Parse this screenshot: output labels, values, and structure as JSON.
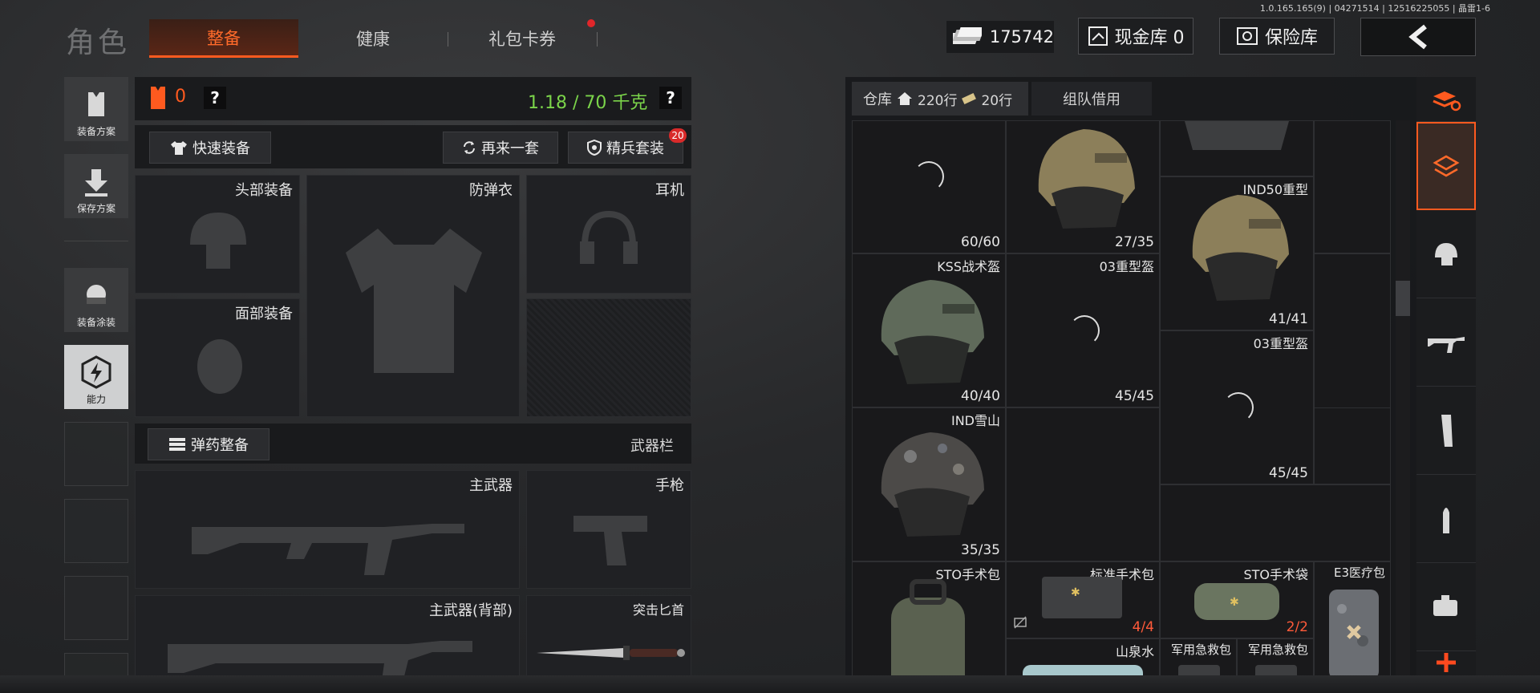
{
  "version": "1.0.165.165(9) | 04271514 | 12516225055 | 晶雷1-6",
  "app_title": "角色",
  "tabs": [
    {
      "label": "整备",
      "active": true
    },
    {
      "label": "健康",
      "active": false
    },
    {
      "label": "礼包卡券",
      "active": false
    }
  ],
  "money": "175742",
  "cash_vault": "现金库 0",
  "insurance_vault": "保险库",
  "sidebar": [
    {
      "label": "装备方案"
    },
    {
      "label": "保存方案"
    },
    {
      "label": "装备涂装"
    },
    {
      "label": "能力"
    }
  ],
  "loadout": {
    "armor_count": "0",
    "help": "?",
    "weight": "1.18 / 70 千克",
    "quick_equip": "快速装备",
    "again": "再来一套",
    "elite": "精兵套装",
    "elite_badge": "20",
    "slots": {
      "head": "头部装备",
      "vest": "防弹衣",
      "headset": "耳机",
      "face": "面部装备",
      "ammo": "弹药整备",
      "weapon_bar": "武器栏",
      "primary": "主武器",
      "pistol": "手枪",
      "primary_back": "主武器(背部)",
      "knife": "突击匕首"
    }
  },
  "warehouse": {
    "tab_label": "仓库",
    "rows_a": "220行",
    "rows_b": "20行",
    "team_borrow": "组队借用",
    "items": [
      {
        "name": "",
        "durability": "60/60"
      },
      {
        "name": "",
        "durability": "27/35"
      },
      {
        "name": "IND50重型",
        "durability": "41/41"
      },
      {
        "name": "KSS战术盔",
        "durability": "40/40"
      },
      {
        "name": "03重型盔",
        "durability": "45/45"
      },
      {
        "name": "03重型盔",
        "durability": "45/45"
      },
      {
        "name": "IND雪山",
        "durability": "35/35"
      },
      {
        "name": "STO手术包",
        "durability": ""
      },
      {
        "name": "标准手术包",
        "durability": "4/4"
      },
      {
        "name": "STO手术袋",
        "durability": "2/2"
      },
      {
        "name": "E3医疗包",
        "durability": ""
      },
      {
        "name": "山泉水",
        "durability": ""
      },
      {
        "name": "军用急救包",
        "durability": ""
      },
      {
        "name": "军用急救包",
        "durability": ""
      }
    ]
  },
  "colors": {
    "accent": "#ff5a1f",
    "weight_green": "#7bd44a",
    "durability_red": "#ff5a3a"
  }
}
